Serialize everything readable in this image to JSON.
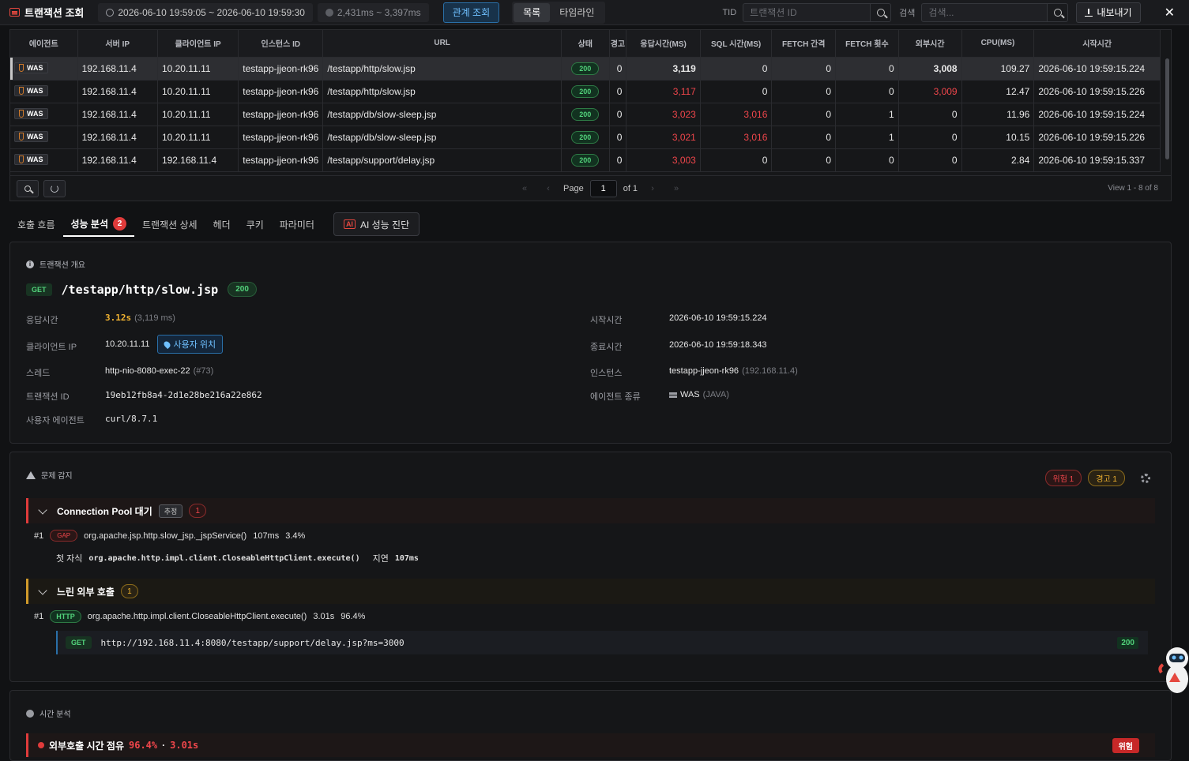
{
  "header": {
    "title": "트랜잭션 조회",
    "time_range": "2026-06-10 19:59:05 ~ 2026-06-10 19:59:30",
    "resp_range": "2,431ms ~ 3,397ms",
    "relation_btn": "관계 조회",
    "view_list": "목록",
    "view_timeline": "타임라인",
    "tid_label": "TID",
    "tid_placeholder": "트랜잭션 ID",
    "search_label": "검색",
    "search_placeholder": "검색...",
    "export_label": "내보내기",
    "close": "✕"
  },
  "table": {
    "columns": [
      "에이전트",
      "서버 IP",
      "클라이언트 IP",
      "인스턴스 ID",
      "URL",
      "상태",
      "경고",
      "응답시간(MS)",
      "SQL 시간(MS)",
      "FETCH 간격",
      "FETCH 횟수",
      "외부시간",
      "CPU(MS)",
      "시작시간"
    ],
    "rows": [
      {
        "agent": "WAS",
        "server_ip": "192.168.11.4",
        "client_ip": "10.20.11.11",
        "instance": "testapp-jjeon-rk96",
        "url": "/testapp/http/slow.jsp",
        "status": "200",
        "warn": "0",
        "resp": "3,119",
        "sql": "0",
        "fetch_gap": "0",
        "fetch_cnt": "0",
        "ext": "3,008",
        "cpu": "109.27",
        "start": "2026-06-10 19:59:15.224"
      },
      {
        "agent": "WAS",
        "server_ip": "192.168.11.4",
        "client_ip": "10.20.11.11",
        "instance": "testapp-jjeon-rk96",
        "url": "/testapp/http/slow.jsp",
        "status": "200",
        "warn": "0",
        "resp": "3,117",
        "sql": "0",
        "fetch_gap": "0",
        "fetch_cnt": "0",
        "ext": "3,009",
        "cpu": "12.47",
        "start": "2026-06-10 19:59:15.226"
      },
      {
        "agent": "WAS",
        "server_ip": "192.168.11.4",
        "client_ip": "10.20.11.11",
        "instance": "testapp-jjeon-rk96",
        "url": "/testapp/db/slow-sleep.jsp",
        "status": "200",
        "warn": "0",
        "resp": "3,023",
        "sql": "3,016",
        "fetch_gap": "0",
        "fetch_cnt": "1",
        "ext": "0",
        "cpu": "11.96",
        "start": "2026-06-10 19:59:15.224"
      },
      {
        "agent": "WAS",
        "server_ip": "192.168.11.4",
        "client_ip": "10.20.11.11",
        "instance": "testapp-jjeon-rk96",
        "url": "/testapp/db/slow-sleep.jsp",
        "status": "200",
        "warn": "0",
        "resp": "3,021",
        "sql": "3,016",
        "fetch_gap": "0",
        "fetch_cnt": "1",
        "ext": "0",
        "cpu": "10.15",
        "start": "2026-06-10 19:59:15.226"
      },
      {
        "agent": "WAS",
        "server_ip": "192.168.11.4",
        "client_ip": "192.168.11.4",
        "instance": "testapp-jjeon-rk96",
        "url": "/testapp/support/delay.jsp",
        "status": "200",
        "warn": "0",
        "resp": "3,003",
        "sql": "0",
        "fetch_gap": "0",
        "fetch_cnt": "0",
        "ext": "0",
        "cpu": "2.84",
        "start": "2026-06-10 19:59:15.337"
      }
    ],
    "pager": {
      "page_label": "Page",
      "page": "1",
      "of_label": "of 1",
      "view_count": "View 1 - 8 of 8"
    }
  },
  "tabs": [
    {
      "label": "호출 흐름"
    },
    {
      "label": "성능 분석",
      "count": "2"
    },
    {
      "label": "트랜잭션 상세"
    },
    {
      "label": "헤더"
    },
    {
      "label": "쿠키"
    },
    {
      "label": "파라미터"
    }
  ],
  "ai_tab": {
    "icon_text": "AI",
    "label": "AI 성능 진단"
  },
  "overview": {
    "heading": "트랜잭션 개요",
    "method": "GET",
    "url": "/testapp/http/slow.jsp",
    "status": "200",
    "resp_label": "응답시간",
    "resp_value": "3.12s",
    "resp_ms": "(3,119 ms)",
    "client_ip_label": "클라이언트 IP",
    "client_ip": "10.20.11.11",
    "user_loc_btn": "사용자 위치",
    "thread_label": "스레드",
    "thread": "http-nio-8080-exec-22",
    "thread_no": "(#73)",
    "txid_label": "트랜잭션 ID",
    "txid": "19eb12fb8a4-2d1e28be216a22e862",
    "ua_label": "사용자 에이전트",
    "ua": "curl/8.7.1",
    "start_label": "시작시간",
    "start": "2026-06-10 19:59:15.224",
    "end_label": "종료시간",
    "end": "2026-06-10 19:59:18.343",
    "instance_label": "인스턴스",
    "instance": "testapp-jjeon-rk96",
    "instance_ip": "(192.168.11.4)",
    "agent_type_label": "에이전트 종류",
    "agent_type": "WAS",
    "agent_lang": "(JAVA)"
  },
  "issues": {
    "heading": "문제 감지",
    "danger_badge": "위험 1",
    "warn_badge": "경고 1",
    "group1": {
      "title": "Connection Pool 대기",
      "tag": "추정",
      "count": "1",
      "idx": "#1",
      "kind": "GAP",
      "method_sig": "org.apache.jsp.http.slow_jsp._jspService()",
      "time": "107ms",
      "pct": "3.4%",
      "child_label": "첫 자식",
      "child_sig": "org.apache.http.impl.client.CloseableHttpClient.execute()",
      "delay_label": "지연",
      "delay": "107ms"
    },
    "group2": {
      "title": "느린 외부 호출",
      "count": "1",
      "idx": "#1",
      "kind": "HTTP",
      "method_sig": "org.apache.http.impl.client.CloseableHttpClient.execute()",
      "time": "3.01s",
      "pct": "96.4%",
      "req_method": "GET",
      "req_url": "http://192.168.11.4:8080/testapp/support/delay.jsp?ms=3000",
      "req_status": "200"
    }
  },
  "time_analysis": {
    "heading": "시간 분석",
    "item_label": "외부호출 시간 점유",
    "item_pct": "96.4%",
    "item_sep": "·",
    "item_time": "3.01s",
    "item_badge": "위험"
  },
  "colors": {
    "accent": "#2a6fa8",
    "danger": "#f0464b",
    "warn": "#f3b431",
    "ok": "#52d27b"
  }
}
